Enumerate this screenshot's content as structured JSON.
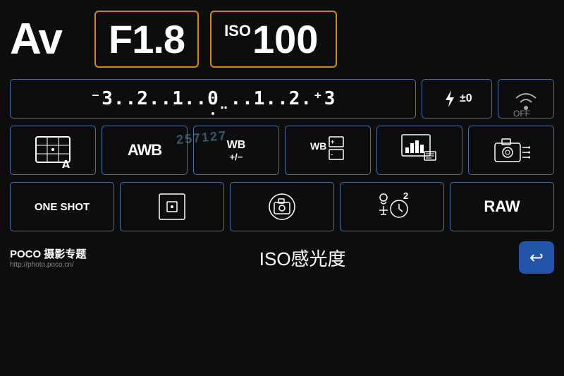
{
  "header": {
    "av_label": "Av",
    "aperture": "F1.8",
    "iso_prefix": "ISO",
    "iso_value": "100"
  },
  "exposure": {
    "scale": "⁻3..2..1..0..1..2.⁺3",
    "flash_comp": "±0",
    "wifi_label": "OFF"
  },
  "icons_row": {
    "metering": "A",
    "wb_auto": "AWB",
    "wb_shift": "WB\n+/−",
    "wb_bracket": "WB",
    "picture_style": "",
    "camera_func": ""
  },
  "buttons_row": {
    "one_shot": "ONE SHOT",
    "af_point": "",
    "live_view": "",
    "drive": "2",
    "raw": "RAW"
  },
  "bottom": {
    "poco_title": "POCO 摄影专题",
    "poco_url": "http://photo.poco.cn/",
    "iso_label": "ISO感光度",
    "back_arrow": "↩"
  },
  "watermark": "257127",
  "colors": {
    "border_blue": "#4a6fa5",
    "border_orange": "#d4870a",
    "back_button_bg": "#2255aa",
    "bg": "#0d0d0d"
  }
}
